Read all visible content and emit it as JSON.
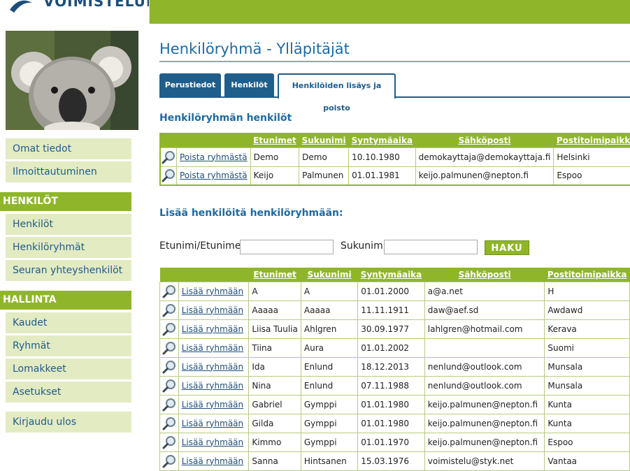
{
  "header": {
    "logo_text": "VOIMISTELULIITTO"
  },
  "sidebar": {
    "top_items": [
      {
        "label": "Omat tiedot"
      },
      {
        "label": "Ilmoittautuminen"
      }
    ],
    "sections": [
      {
        "title": "HENKILÖT",
        "items": [
          {
            "label": "Henkilöt"
          },
          {
            "label": "Henkilöryhmät"
          },
          {
            "label": "Seuran yhteyshenkilöt"
          }
        ]
      },
      {
        "title": "HALLINTA",
        "items": [
          {
            "label": "Kaudet"
          },
          {
            "label": "Ryhmät"
          },
          {
            "label": "Lomakkeet"
          },
          {
            "label": "Asetukset"
          }
        ]
      }
    ],
    "logout_label": "Kirjaudu ulos"
  },
  "page": {
    "title": "Henkilöryhmä - Ylläpitäjät",
    "tabs": [
      {
        "label": "Perustiedot"
      },
      {
        "label": "Henkilöt"
      },
      {
        "label": "Henkilöiden lisäys ja poisto"
      }
    ]
  },
  "members": {
    "title": "Henkilöryhmän henkilöt",
    "columns": [
      "Etunimet",
      "Sukunimi",
      "Syntymäaika",
      "Sähköposti",
      "Postitoimipaikka"
    ],
    "action_label": "Poista ryhmästä",
    "rows": [
      [
        "Demo",
        "Demo",
        "10.10.1980",
        "demokayttaja@demokayttaja.fi",
        "Helsinki"
      ],
      [
        "Keijo",
        "Palmunen",
        "01.01.1981",
        "keijo.palmunen@nepton.fi",
        "Espoo"
      ]
    ]
  },
  "add": {
    "title": "Lisää henkilöitä henkilöryhmään:",
    "first_name_label": "Etunimi/Etunimet",
    "last_name_label": "Sukunimi",
    "first_name_value": "",
    "last_name_value": "",
    "search_button": "HAKU"
  },
  "results": {
    "columns": [
      "Etunimet",
      "Sukunimi",
      "Syntymäaika",
      "Sähköposti",
      "Postitoimipaikka"
    ],
    "action_label": "Lisää ryhmään",
    "rows": [
      [
        "A",
        "A",
        "01.01.2000",
        "a@a.net",
        "H"
      ],
      [
        "Aaaaa",
        "Aaaaa",
        "11.11.1911",
        "daw@aef.sd",
        "Awdawd"
      ],
      [
        "Liisa Tuulia",
        "Ahlgren",
        "30.09.1977",
        "lahlgren@hotmail.com",
        "Kerava"
      ],
      [
        "Tiina",
        "Aura",
        "01.01.2002",
        "",
        "Suomi"
      ],
      [
        "Ida",
        "Enlund",
        "18.12.2013",
        "nenlund@outlook.com",
        "Munsala"
      ],
      [
        "Nina",
        "Enlund",
        "07.11.1988",
        "nenlund@outlook.com",
        "Munsala"
      ],
      [
        "Gabriel",
        "Gymppi",
        "01.01.1980",
        "keijo.palmunen@nepton.fi",
        "Kunta"
      ],
      [
        "Gilda",
        "Gymppi",
        "01.01.1980",
        "keijo.palmunen@nepton.fi",
        "Kunta"
      ],
      [
        "Kimmo",
        "Gymppi",
        "01.01.1970",
        "keijo.palmunen@nepton.fi",
        "Espoo"
      ],
      [
        "Sanna",
        "Hintsanen",
        "15.03.1976",
        "voimistelu@styk.net",
        "Vantaa"
      ]
    ]
  }
}
